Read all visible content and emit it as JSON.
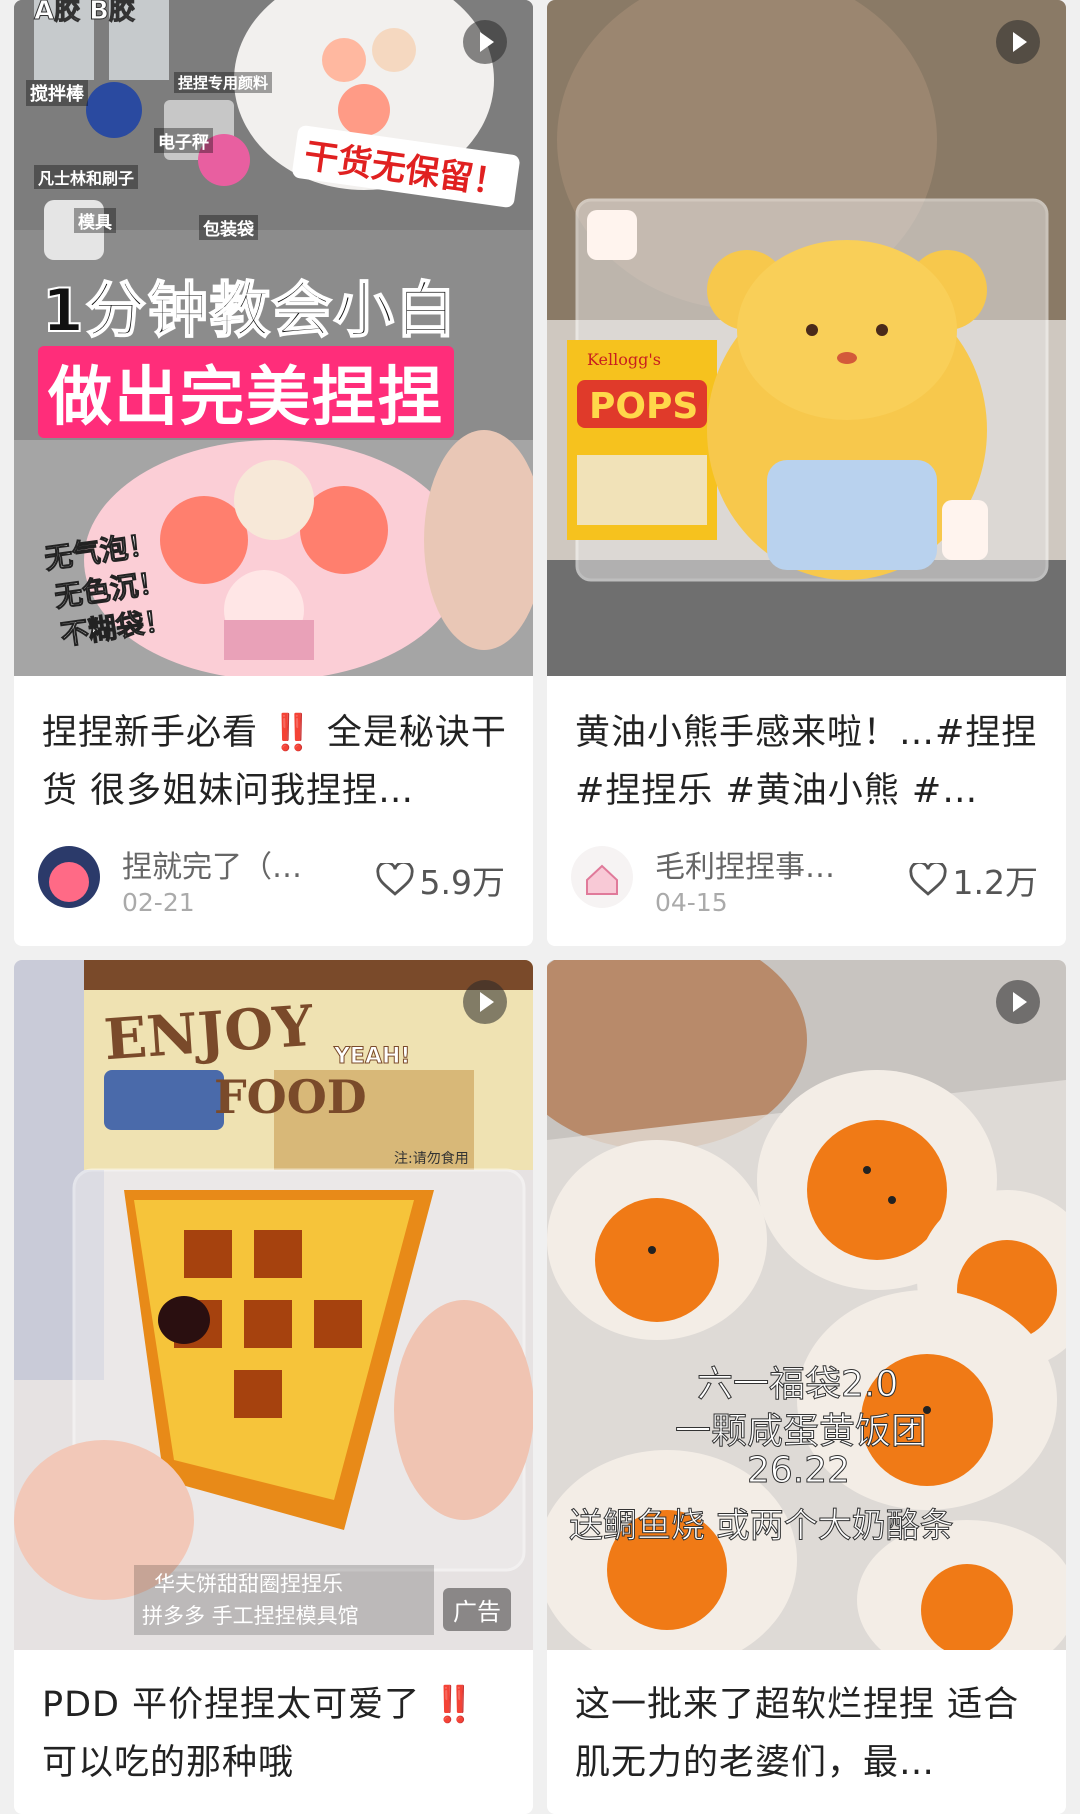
{
  "cards": [
    {
      "title": "捏捏新手必看 ‼️ 全是秘诀干货 很多姐妹问我捏捏…",
      "author": "捏就完了（…",
      "date": "02-21",
      "likes": "5.9万",
      "overlay": {
        "headline1": "1分钟教会小白",
        "headline2": "做出完美捏捏",
        "tag": "干货无保留！",
        "features": [
          "无气泡！",
          "无色沉！",
          "不糊袋！"
        ],
        "labels": [
          "搅拌棒",
          "捏捏专用颜料",
          "电子秤",
          "凡士林和刷子",
          "模具",
          "包装袋"
        ],
        "ab": "A胶  B胶"
      }
    },
    {
      "title": "黄油小熊手感来啦！…#捏捏 #捏捏乐 #黄油小熊 #…",
      "author": "毛利捏捏事…",
      "date": "04-15",
      "likes": "1.2万",
      "overlay": {
        "box": "POPS",
        "brand": "Kellogg's"
      }
    },
    {
      "title": "PDD 平价捏捏太可爱了 ‼️ 可以吃的那种哦",
      "ad": "广告",
      "overlay": {
        "enjoy": "ENJOY",
        "food": "FOOD",
        "yeah": "YEAH!",
        "note": "注:请勿食用",
        "caption1": "华夫饼甜甜圈捏捏乐",
        "caption2": "拼多多  手工捏捏模具馆"
      }
    },
    {
      "title": "这一批来了超软烂捏捏 适合肌无力的老婆们，最…",
      "overlay": {
        "lines": [
          "六一福袋2.0",
          "一颗咸蛋黄饭团",
          "26.22",
          "送鲷鱼烧 或两个大奶酪条"
        ]
      }
    }
  ],
  "colors": {
    "background": "#f0f0f0",
    "card": "#ffffff",
    "title": "#222222",
    "meta": "#999999",
    "accent_pink": "#ff2d7a"
  }
}
